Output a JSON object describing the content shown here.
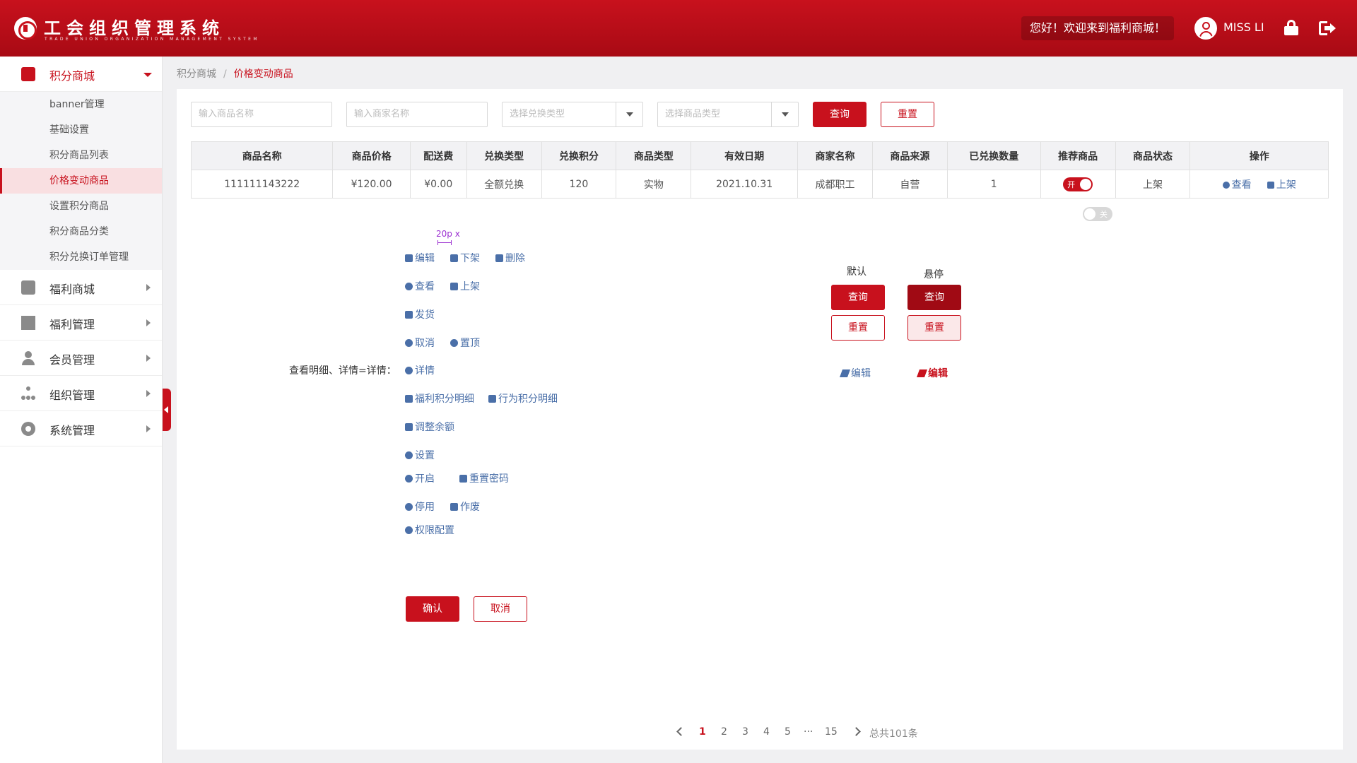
{
  "header": {
    "title": "工会组织管理系统",
    "subtitle": "TRADE UNION ORGANIZATION MANAGEMENT SYSTEM",
    "welcome": "您好！欢迎来到福利商城！",
    "user": "MISS LI",
    "brand_color": "#c8111d"
  },
  "sidebar": {
    "open_group": {
      "label": "积分商城",
      "icon": "shop-bag-icon"
    },
    "sub_items": [
      {
        "label": "banner管理"
      },
      {
        "label": "基础设置"
      },
      {
        "label": "积分商品列表"
      },
      {
        "label": "价格变动商品"
      },
      {
        "label": "设置积分商品"
      },
      {
        "label": "积分商品分类"
      },
      {
        "label": "积分兑换订单管理"
      }
    ],
    "active_sub": "价格变动商品",
    "groups": [
      {
        "label": "福利商城",
        "icon": "store-icon"
      },
      {
        "label": "福利管理",
        "icon": "gift-icon"
      },
      {
        "label": "会员管理",
        "icon": "user-icon"
      },
      {
        "label": "组织管理",
        "icon": "org-tree-icon"
      },
      {
        "label": "系统管理",
        "icon": "gear-icon"
      }
    ]
  },
  "breadcrumb": {
    "root": "积分商城",
    "sep": "/",
    "current": "价格变动商品"
  },
  "filters": {
    "product_name_placeholder": "输入商品名称",
    "merchant_name_placeholder": "输入商家名称",
    "exchange_type_placeholder": "选择兑换类型",
    "product_type_placeholder": "选择商品类型",
    "search_label": "查询",
    "reset_label": "重置"
  },
  "table": {
    "headers": [
      "商品名称",
      "商品价格",
      "配送费",
      "兑换类型",
      "兑换积分",
      "商品类型",
      "有效日期",
      "商家名称",
      "商品来源",
      "已兑换数量",
      "推荐商品",
      "商品状态",
      "操作"
    ],
    "rows": [
      {
        "name": "111111143222",
        "price": "¥120.00",
        "delivery": "¥0.00",
        "exchange_type": "全额兑换",
        "points": "120",
        "product_type": "实物",
        "valid_date": "2021.10.31",
        "merchant": "成都职工",
        "source": "自营",
        "exchanged": "1",
        "recommend_toggle": "开",
        "status": "上架",
        "op_view": "查看",
        "op_shelf": "上架"
      }
    ],
    "off_toggle_label": "关"
  },
  "guide": {
    "measure": "20p x",
    "label": "查看明细、详情=详情：",
    "rows": [
      [
        {
          "icon": "pencil-icon",
          "text": "编辑"
        },
        {
          "icon": "box-icon",
          "text": "下架"
        },
        {
          "icon": "trash-icon",
          "text": "删除"
        }
      ],
      [
        {
          "icon": "eye-icon",
          "text": "查看"
        },
        {
          "icon": "box-icon",
          "text": "上架"
        }
      ],
      [
        {
          "icon": "truck-icon",
          "text": "发货"
        }
      ],
      [
        {
          "icon": "close-circle-icon",
          "text": "取消"
        },
        {
          "icon": "top-circle-icon",
          "text": "置顶"
        }
      ],
      [
        {
          "icon": "more-circle-icon",
          "text": "详情"
        }
      ],
      [
        {
          "icon": "list-icon",
          "text": "福利积分明细"
        },
        {
          "icon": "database-icon",
          "text": "行为积分明细"
        }
      ],
      [
        {
          "icon": "wallet-icon",
          "text": "调整余额"
        }
      ],
      [
        {
          "icon": "gear-icon",
          "text": "设置"
        }
      ],
      [
        {
          "icon": "play-circle-icon",
          "text": "开启"
        },
        {
          "icon": "lock-icon",
          "text": "重置密码"
        }
      ],
      [
        {
          "icon": "minus-circle-icon",
          "text": "停用"
        },
        {
          "icon": "void-doc-icon",
          "text": "作废"
        }
      ],
      [
        {
          "icon": "shield-icon",
          "text": "权限配置"
        }
      ]
    ],
    "confirm_label": "确认",
    "cancel_label": "取消"
  },
  "states": {
    "default_title": "默认",
    "hover_title": "悬停",
    "search_label": "查询",
    "reset_label": "重置",
    "edit_label": "编辑"
  },
  "pagination": {
    "pages": [
      "1",
      "2",
      "3",
      "4",
      "5"
    ],
    "ellipsis": "···",
    "last": "15",
    "total": "总共101条",
    "current": "1"
  }
}
